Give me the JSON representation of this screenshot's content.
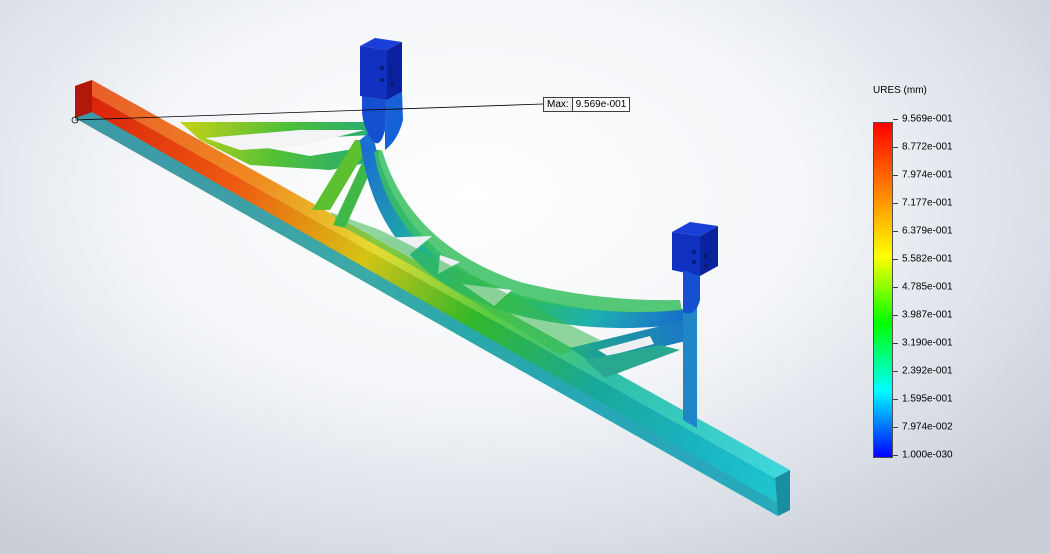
{
  "result_plot": {
    "quantity": "URES (mm)",
    "max_label": "Max:",
    "max_value": "9.569e-001"
  },
  "legend": {
    "title": "URES (mm)",
    "ticks": [
      "9.569e-001",
      "8.772e-001",
      "7.974e-001",
      "7.177e-001",
      "6.379e-001",
      "5.582e-001",
      "4.785e-001",
      "3.987e-001",
      "3.190e-001",
      "2.392e-001",
      "1.595e-001",
      "7.974e-002",
      "1.000e-030"
    ],
    "colors": [
      "#ff0000",
      "#ff8000",
      "#ffff00",
      "#00ff00",
      "#00ffff",
      "#0000ff"
    ]
  }
}
